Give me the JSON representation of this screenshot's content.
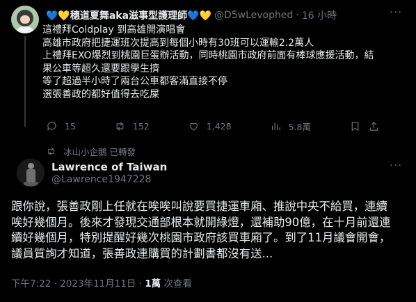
{
  "tweet1": {
    "display_name": "💙💛穗道夏舞aka滋事型護理師💙💛",
    "handle": "@D5wLevophed",
    "separator": "·",
    "time": "16 小時",
    "more": "···",
    "lines": [
      "這禮拜Coldplay 到高雄開演唱會",
      "高雄市政府把捷運班次提高到每個小時有30班可以運輸2.2萬人",
      "上禮拜EXO爆烈到桃園巨蛋辦活動，同時桃園市政府前面有棒球應援活動，結",
      "果公車等超久還要跟學生擠",
      "等了超過半小時了兩台公車都客滿直接不停",
      "選張善政的都好值得去吃屎"
    ],
    "stats": {
      "replies": "15",
      "retweets": "152",
      "likes": "1,428",
      "views": "5.8萬"
    }
  },
  "retweet_label": "冰山小企鵝 已轉發",
  "tweet2": {
    "display_name": "Lawrence of Taiwan",
    "handle": "@Lawrence1947228",
    "more": "···",
    "lines": [
      "跟你說，張善政剛上任就在唉唉叫說要買捷運車廂、推說中央不給買，連續",
      "唉好幾個月。後來才發現交通部根本就開綠燈，還補助90億，在十月前還連",
      "續好幾個月，特別提醒好幾次桃園市政府該買車廂了。到了11月議會開會，",
      "議員質詢才知道，張善政連購買的計劃書都沒有送..."
    ],
    "timestamp": "下午7:22 · 2023年11月11日 · ",
    "views_count": "1萬",
    "views_label": " 次查看"
  },
  "icons": [
    "reply-icon",
    "retweet-icon",
    "like-icon",
    "views-icon",
    "bookmark-icon",
    "share-icon",
    "more-icon"
  ],
  "colors": {
    "background": "#000000",
    "text": "#e7e9ea",
    "muted": "#71767b"
  }
}
